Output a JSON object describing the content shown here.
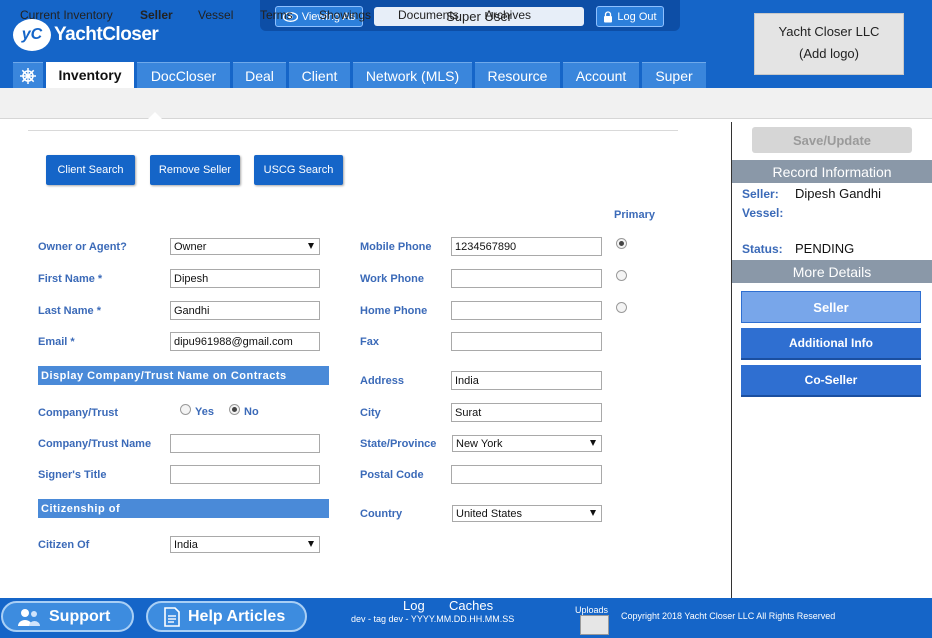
{
  "header": {
    "logo_mark": "yC",
    "logo_text": "YachtCloser",
    "viewing_as_label": "Viewing As",
    "current_user": "Super User",
    "logout_label": "Log Out",
    "company_name": "Yacht Closer LLC",
    "add_logo": "(Add logo)"
  },
  "main_tabs": [
    {
      "label": "Inventory",
      "active": true
    },
    {
      "label": "DocCloser"
    },
    {
      "label": "Deal"
    },
    {
      "label": "Client"
    },
    {
      "label": "Network (MLS)"
    },
    {
      "label": "Resource"
    },
    {
      "label": "Account"
    },
    {
      "label": "Super"
    }
  ],
  "sub_nav": [
    {
      "label": "Current Inventory"
    },
    {
      "label": "Seller",
      "active": true
    },
    {
      "label": "Vessel"
    },
    {
      "label": "Terms"
    },
    {
      "label": "Showings"
    },
    {
      "label": "Documents"
    },
    {
      "label": "Archives"
    }
  ],
  "actions": {
    "client_search": "Client Search",
    "remove_seller": "Remove Seller",
    "uscg_search": "USCG Search"
  },
  "form": {
    "primary_header": "Primary",
    "owner_or_agent": {
      "label": "Owner or Agent?",
      "value": "Owner"
    },
    "first_name": {
      "label": "First Name *",
      "value": "Dipesh"
    },
    "last_name": {
      "label": "Last Name *",
      "value": "Gandhi"
    },
    "email": {
      "label": "Email *",
      "value": "dipu961988@gmail.com"
    },
    "display_company_section": "Display Company/Trust Name on Contracts",
    "company_trust": {
      "label": "Company/Trust",
      "yes": "Yes",
      "no": "No",
      "selected": "No"
    },
    "company_trust_name": {
      "label": "Company/Trust Name",
      "value": ""
    },
    "signers_title": {
      "label": "Signer's Title",
      "value": ""
    },
    "citizenship_section": "Citizenship of",
    "citizen_of": {
      "label": "Citizen Of",
      "value": "India"
    },
    "mobile_phone": {
      "label": "Mobile Phone",
      "value": "1234567890",
      "primary": true
    },
    "work_phone": {
      "label": "Work Phone",
      "value": "",
      "primary": false
    },
    "home_phone": {
      "label": "Home Phone",
      "value": "",
      "primary": false
    },
    "fax": {
      "label": "Fax",
      "value": ""
    },
    "address": {
      "label": "Address",
      "value": "India"
    },
    "city": {
      "label": "City",
      "value": "Surat"
    },
    "state_province": {
      "label": "State/Province",
      "value": "New York"
    },
    "postal_code": {
      "label": "Postal Code",
      "value": ""
    },
    "country": {
      "label": "Country",
      "value": "United States"
    }
  },
  "right_panel": {
    "save_update": "Save/Update",
    "record_information": "Record Information",
    "seller_label": "Seller:",
    "seller_value": "Dipesh Gandhi",
    "vessel_label": "Vessel:",
    "vessel_value": "",
    "status_label": "Status:",
    "status_value": "PENDING",
    "more_details": "More Details",
    "buttons": [
      {
        "label": "Seller",
        "active": true
      },
      {
        "label": "Additional Info"
      },
      {
        "label": "Co-Seller"
      }
    ]
  },
  "footer": {
    "support": "Support",
    "help_articles": "Help Articles",
    "log": "Log",
    "caches": "Caches",
    "build": "dev - tag dev - YYYY.MM.DD.HH.MM.SS",
    "uploads": "Uploads",
    "copyright": "Copyright 2018 Yacht Closer LLC All Rights Reserved"
  },
  "colors": {
    "brand_blue": "#1565c8",
    "label_blue": "#3b6ab8",
    "section_blue": "#4a8ad8",
    "panel_gray": "#8a98a8"
  }
}
